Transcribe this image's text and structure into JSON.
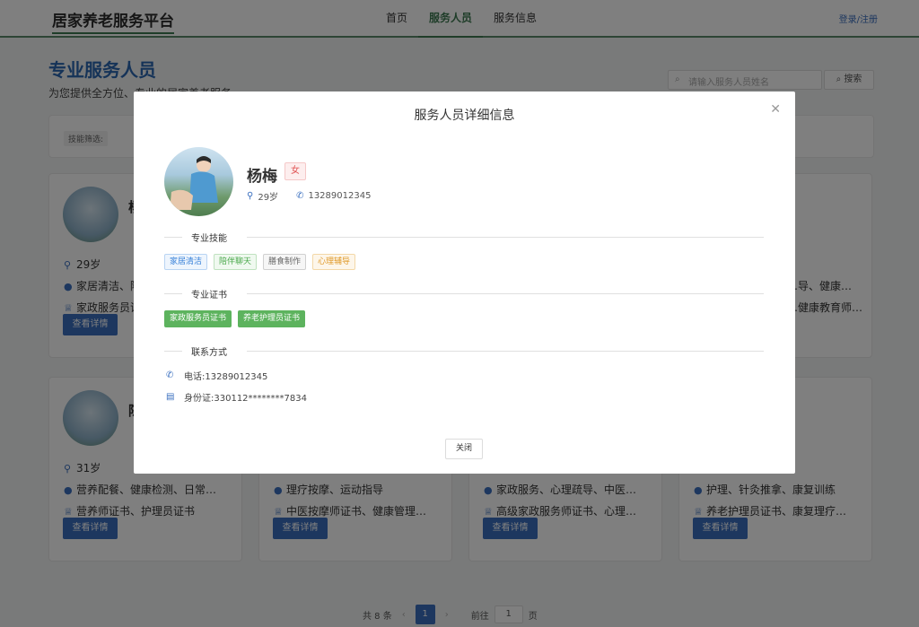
{
  "header": {
    "logo": "居家养老服务平台",
    "nav": [
      "首页",
      "服务人员",
      "服务信息"
    ],
    "login": "登录/注册"
  },
  "page": {
    "title": "专业服务人员",
    "subtitle": "为您提供全方位、专业的居家养老服务",
    "search_placeholder": "请输入服务人员姓名",
    "search_button": "搜索",
    "filter_label": "技能筛选:"
  },
  "cards": [
    {
      "name": "杨梅",
      "age": "29岁",
      "skills": "家居清洁、陪伴聊天、膳食制作、心理辅导",
      "certs": "家政服务员证书、养老护理员证书",
      "button": "查看详情"
    },
    {
      "name": "",
      "age": "",
      "skills": "",
      "certs": "",
      "button": ""
    },
    {
      "name": "",
      "age": "",
      "skills": "",
      "certs": "",
      "button": ""
    },
    {
      "name": "",
      "age": "",
      "skills": "…导、健康…",
      "certs": "…健康教育师…",
      "button": ""
    },
    {
      "name": "陈",
      "age": "31岁",
      "skills": "营养配餐、健康检测、日常…",
      "certs": "营养师证书、护理员证书",
      "button": "查看详情"
    },
    {
      "name": "",
      "age": "",
      "skills": "理疗按摩、运动指导",
      "certs": "中医按摩师证书、健康管理…",
      "button": "查看详情"
    },
    {
      "name": "",
      "age": "",
      "skills": "家政服务、心理疏导、中医…",
      "certs": "高级家政服务师证书、心理…",
      "button": "查看详情"
    },
    {
      "name": "",
      "age": "",
      "skills": "护理、针灸推拿、康复训练",
      "certs": "养老护理员证书、康复理疗…",
      "button": "查看详情"
    }
  ],
  "pagination": {
    "total": "共 8 条",
    "current": "1",
    "goto_label": "前往",
    "goto_value": "1",
    "page_unit": "页"
  },
  "modal": {
    "title": "服务人员详细信息",
    "name": "杨梅",
    "gender": "女",
    "age": "29岁",
    "phone": "13289012345",
    "skills_title": "专业技能",
    "skills": [
      {
        "label": "家居清洁",
        "color": "blue"
      },
      {
        "label": "陪伴聊天",
        "color": "green"
      },
      {
        "label": "膳食制作",
        "color": "gray"
      },
      {
        "label": "心理辅导",
        "color": "orange"
      }
    ],
    "certs_title": "专业证书",
    "certs": [
      "家政服务员证书",
      "养老护理员证书"
    ],
    "contact_title": "联系方式",
    "contact_phone_label": "电话:13289012345",
    "contact_id_label": "身份证:330112********7834",
    "close_button": "关闭"
  },
  "colors": {
    "primary": "#3a6fbf",
    "brand_green": "#3e7b52",
    "cert_green": "#5db35e"
  }
}
